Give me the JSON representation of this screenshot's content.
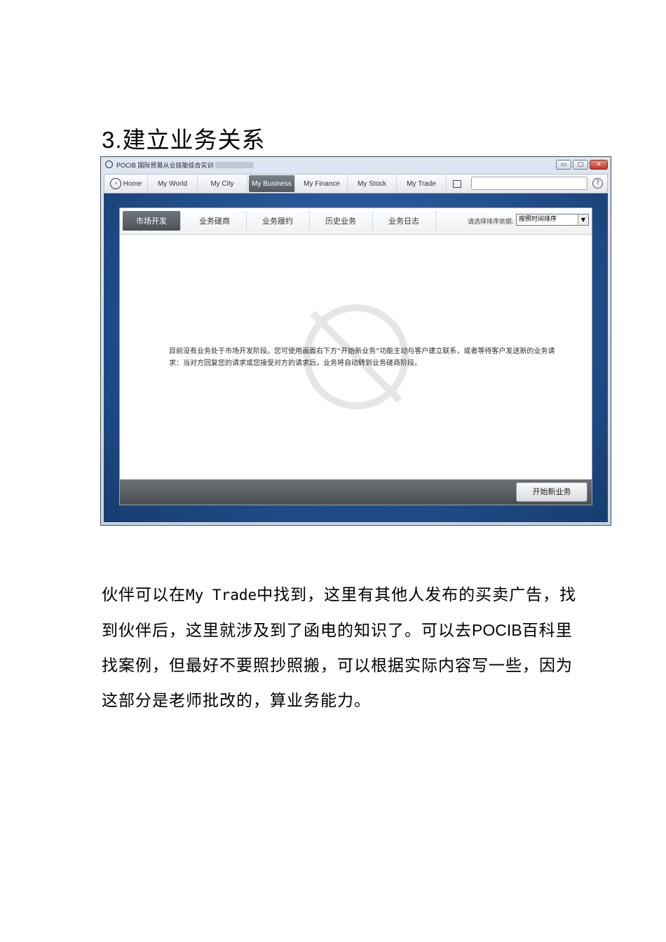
{
  "heading": {
    "number": "3.",
    "text": "建立业务关系"
  },
  "window": {
    "title": "POCIB 国际贸易从业技能综合实训 -",
    "controls": {
      "minimize": "▭",
      "maximize": "▢",
      "close": "✕"
    },
    "nav": {
      "items": [
        "Home",
        "My World",
        "My City",
        "My Business",
        "My Finance",
        "My Stock",
        "My Trade"
      ],
      "active_index": 3,
      "help": "?"
    },
    "tabs": [
      "市场开发",
      "业务磋商",
      "业务履约",
      "历史业务",
      "业务日志"
    ],
    "active_tab": 0,
    "sort": {
      "label": "请选择排序依据:",
      "value": "按照时间排序",
      "arrow": "▼"
    },
    "empty_message": "目前没有业务处于市场开发阶段。您可使用画面右下方“开始新业务”功能主动与客户建立联系，或者等待客户发送新的业务请求：当对方回复您的请求或您接受对方的请求后，业务将自动转到业务磋商阶段。",
    "new_business_button": "开始新业务"
  },
  "paragraph": {
    "part1": "伙伴可以在",
    "part2": "My Trade",
    "part3": "中找到，这里有其他人发布的买卖广告，找到伙伴后，这里就涉及到了函电的知识了。可以去",
    "part4": "POCIB",
    "part5": "百科里找案例，但最好不要照抄照搬，可以根据实际内容写一些，因为这部分是老师批改的，算业务能力。"
  }
}
